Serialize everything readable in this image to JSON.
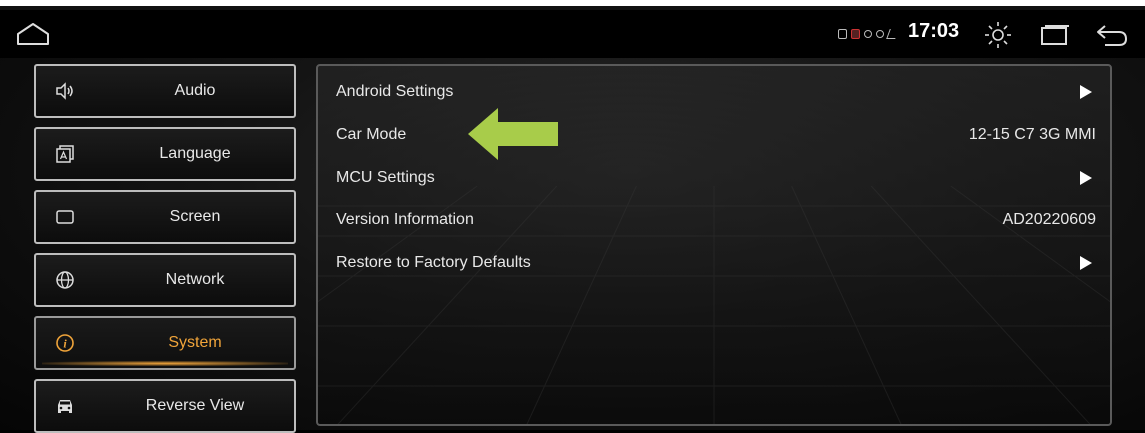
{
  "status": {
    "time": "17:03"
  },
  "sidebar": {
    "items": [
      {
        "label": "Audio",
        "icon": "speaker-icon"
      },
      {
        "label": "Language",
        "icon": "language-icon"
      },
      {
        "label": "Screen",
        "icon": "screen-icon"
      },
      {
        "label": "Network",
        "icon": "globe-icon"
      },
      {
        "label": "System",
        "icon": "info-icon",
        "active": true
      },
      {
        "label": "Reverse View",
        "icon": "car-icon"
      }
    ]
  },
  "settings": {
    "rows": [
      {
        "label": "Android Settings",
        "value": ""
      },
      {
        "label": "Car Mode",
        "value": "12-15 C7 3G MMI"
      },
      {
        "label": "MCU Settings",
        "value": ""
      },
      {
        "label": "Version Information",
        "value": "AD20220609"
      },
      {
        "label": "Restore to Factory Defaults",
        "value": ""
      }
    ]
  },
  "colors": {
    "accent": "#f0a43a",
    "arrow": "#a8cc4a"
  }
}
